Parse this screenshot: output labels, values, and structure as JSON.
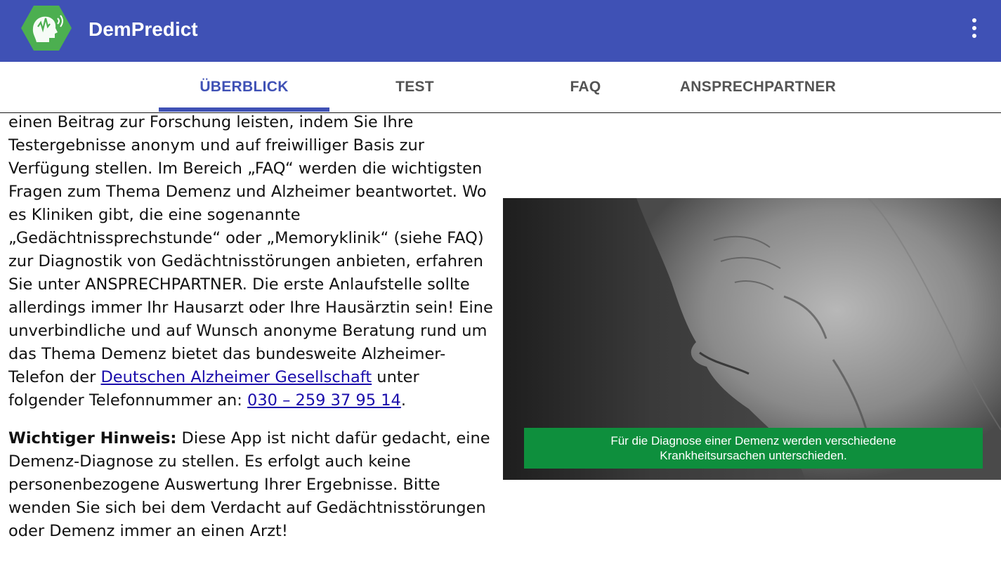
{
  "app": {
    "title": "DemPredict",
    "logo_icon": "brain-signal-hexagon-icon",
    "menu_icon": "more-vertical-icon",
    "bar_color": "#3f51b5",
    "logo_color": "#4caf50"
  },
  "tabs": [
    {
      "label": "ÜBERBLICK",
      "active": true
    },
    {
      "label": "TEST",
      "active": false
    },
    {
      "label": "FAQ",
      "active": false
    },
    {
      "label": "ANSPRECHPARTNER",
      "active": false
    }
  ],
  "content": {
    "paragraph1": {
      "text_before_link1": "einen Beitrag zur Forschung leisten, indem Sie Ihre Testergebnisse anonym und auf freiwilliger Basis zur Verfügung stellen. Im Bereich „FAQ“ werden die wichtigsten Fragen zum Thema Demenz und Alzheimer beantwortet. Wo es Kliniken gibt, die eine sogenannte „Gedächtnissprechstunde“ oder „Memoryklinik“ (siehe FAQ) zur Diagnostik von Gedächtnisstörungen anbieten, erfahren Sie unter ANSPRECHPARTNER. Die erste Anlaufstelle sollte allerdings immer Ihr Hausarzt oder Ihre Hausärztin sein! Eine unverbindliche und auf Wunsch anonyme Beratung rund um das Thema Demenz bietet das bundesweite Alzheimer-Telefon der ",
      "link1": "Deutschen Alzheimer Gesellschaft",
      "text_between": " unter folgender Telefonnummer an: ",
      "link2": "030 – 259 37 95 14",
      "text_after": "."
    },
    "paragraph2": {
      "label": "Wichtiger Hinweis:",
      "text": " Diese App ist nicht dafür gedacht, eine Demenz-Diagnose zu stellen. Es erfolgt auch keine personenbezogene Auswertung Ihrer Ergebnisse. Bitte wenden Sie sich bei dem Verdacht auf Gedächtnisstörungen oder Demenz immer an einen Arzt!"
    },
    "link_color": "#1a0dab"
  },
  "image": {
    "subject": "black-and-white portrait of an elderly man looking down",
    "caption_line1": "Für die Diagnose einer Demenz werden verschiedene",
    "caption_line2": "Krankheitsursachen unterschieden.",
    "caption_bg": "#0e8f3d"
  }
}
